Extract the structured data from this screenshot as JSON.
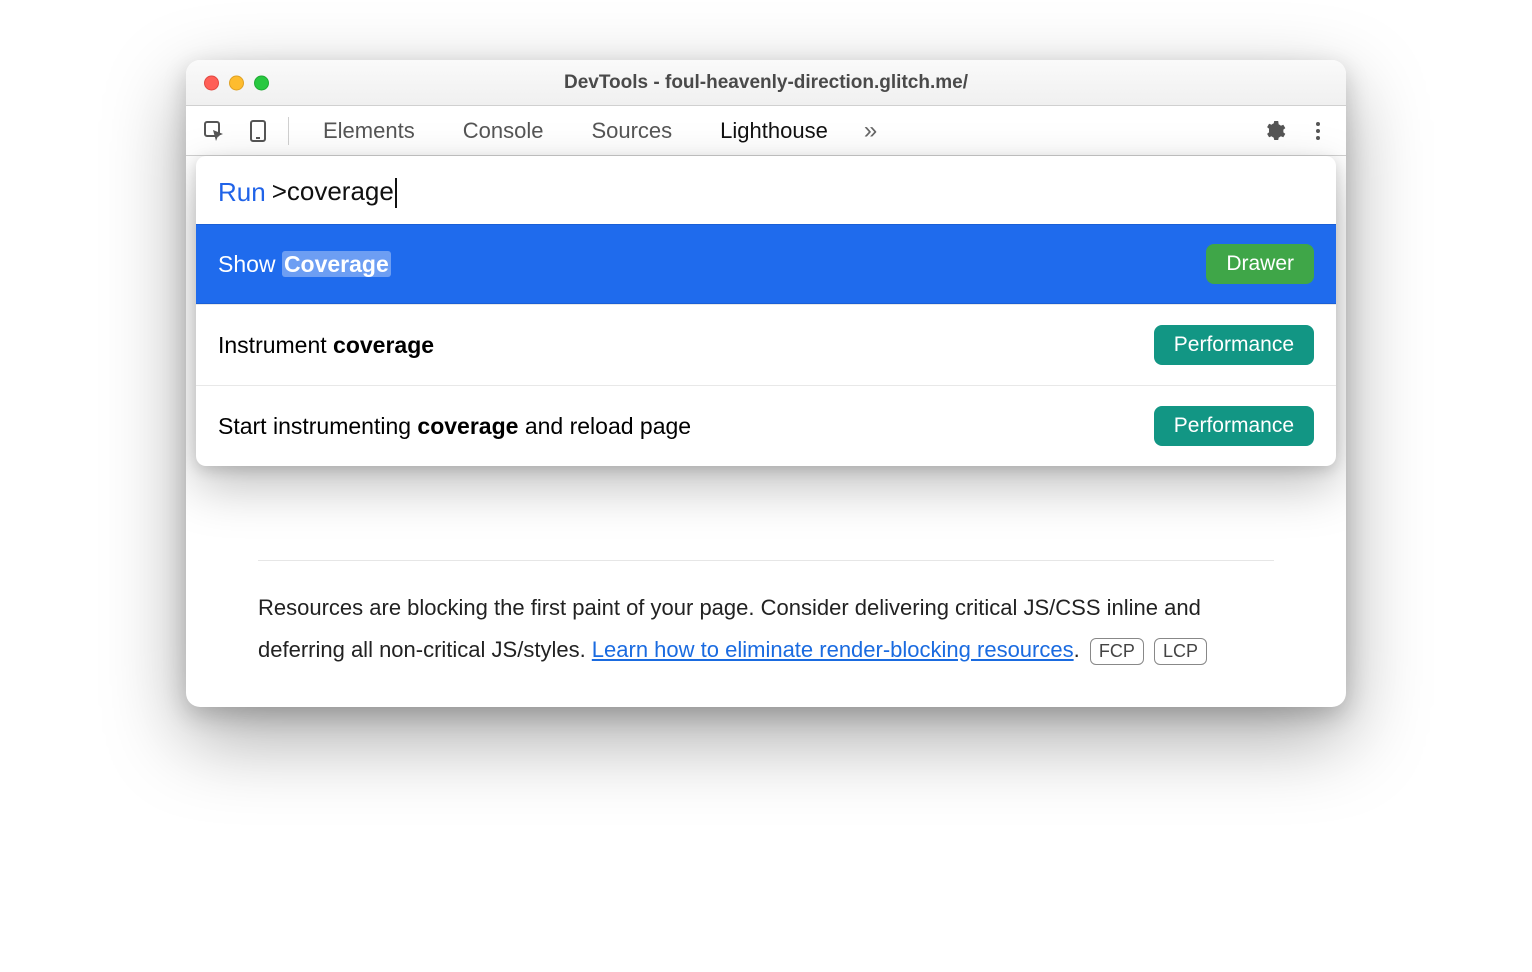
{
  "window": {
    "title": "DevTools - foul-heavenly-direction.glitch.me/"
  },
  "toolbar": {
    "tabs": [
      "Elements",
      "Console",
      "Sources",
      "Lighthouse"
    ],
    "active_tab_index": 3
  },
  "command_menu": {
    "prompt_label": "Run",
    "prompt_prefix": ">",
    "input_value": "coverage",
    "items": [
      {
        "pre": "Show ",
        "match": "Coverage",
        "post": "",
        "badge": "Drawer",
        "badge_kind": "drawer",
        "selected": true
      },
      {
        "pre": "Instrument ",
        "match": "coverage",
        "post": "",
        "badge": "Performance",
        "badge_kind": "perf",
        "selected": false
      },
      {
        "pre": "Start instrumenting ",
        "match": "coverage",
        "post": " and reload page",
        "badge": "Performance",
        "badge_kind": "perf",
        "selected": false
      }
    ]
  },
  "audit": {
    "text_before_link": "Resources are blocking the first paint of your page. Consider delivering critical JS/CSS inline and deferring all non-critical JS/styles. ",
    "link_text": "Learn how to eliminate render-blocking resources",
    "text_after_link": ".",
    "chips": [
      "FCP",
      "LCP"
    ]
  }
}
